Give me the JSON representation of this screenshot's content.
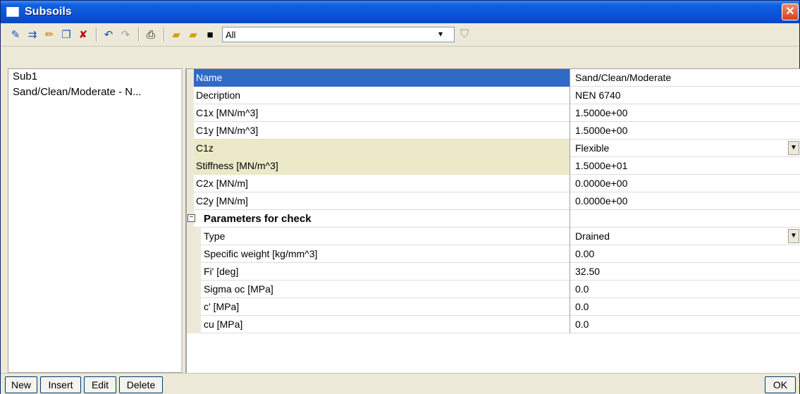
{
  "window": {
    "title": "Subsoils",
    "close_label": "✕"
  },
  "toolbar": {
    "icons": [
      "new-record-icon",
      "insert-icon",
      "edit-pencil-icon",
      "copy-icon",
      "delete-icon",
      "undo-icon",
      "redo-icon",
      "print-icon",
      "open-folder-icon",
      "import-folder-icon",
      "save-disk-icon"
    ],
    "filter": {
      "value": "All",
      "arrow": "▾"
    },
    "funnel_glyph": "⛉"
  },
  "list": {
    "items": [
      "Sub1",
      "Sand/Clean/Moderate - N..."
    ]
  },
  "grid": {
    "rows": [
      {
        "name": "Name",
        "value": "Sand/Clean/Moderate"
      },
      {
        "name": "Decription",
        "value": "NEN 6740"
      },
      {
        "name": "C1x [MN/m^3]",
        "value": "1.5000e+00"
      },
      {
        "name": "C1y [MN/m^3]",
        "value": "1.5000e+00"
      },
      {
        "name": "C1z",
        "value": "Flexible"
      },
      {
        "name": "Stiffness [MN/m^3]",
        "value": "1.5000e+01"
      },
      {
        "name": "C2x [MN/m]",
        "value": "0.0000e+00"
      },
      {
        "name": "C2y [MN/m]",
        "value": "0.0000e+00"
      },
      {
        "name": "Parameters for check",
        "value": ""
      },
      {
        "name": "Type",
        "value": "Drained"
      },
      {
        "name": "Specific weight [kg/mm^3]",
        "value": "0.00"
      },
      {
        "name": "Fi' [deg]",
        "value": "32.50"
      },
      {
        "name": "Sigma oc [MPa]",
        "value": "0.0"
      },
      {
        "name": "c' [MPa]",
        "value": "0.0"
      },
      {
        "name": "cu [MPa]",
        "value": "0.0"
      }
    ],
    "expander_glyph": "−",
    "dropdown_glyph": "▼"
  },
  "buttons": {
    "new": "New",
    "insert": "Insert",
    "edit": "Edit",
    "delete": "Delete",
    "ok": "OK"
  },
  "colors": {
    "titlebar": "#0a54d8",
    "selection": "#316ac5",
    "highlight_row": "#ece9c8",
    "face": "#ece9d8"
  }
}
